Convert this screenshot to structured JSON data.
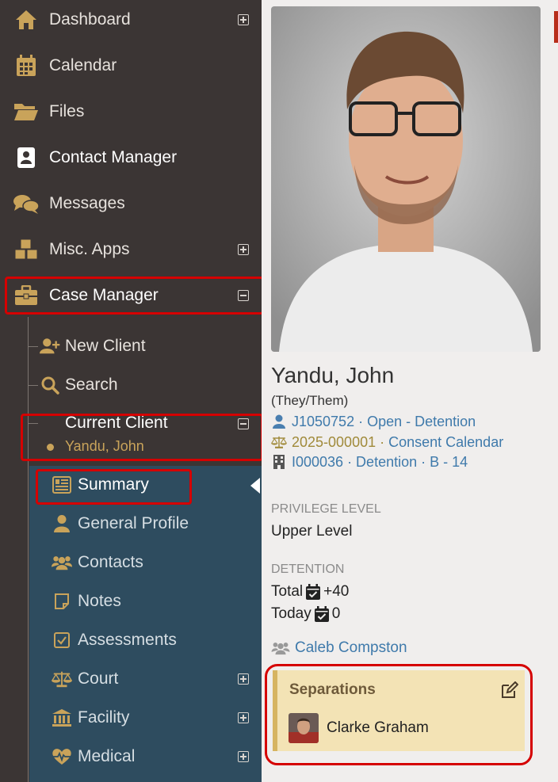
{
  "sidebar": {
    "items": [
      {
        "label": "Dashboard",
        "icon": "home-icon",
        "expander": "plus"
      },
      {
        "label": "Calendar",
        "icon": "calendar-icon",
        "expander": ""
      },
      {
        "label": "Files",
        "icon": "folder-icon",
        "expander": ""
      },
      {
        "label": "Contact Manager",
        "icon": "contact-card-icon",
        "expander": ""
      },
      {
        "label": "Messages",
        "icon": "chat-bubbles-icon",
        "expander": ""
      },
      {
        "label": "Misc. Apps",
        "icon": "cubes-icon",
        "expander": "plus"
      },
      {
        "label": "Case Manager",
        "icon": "briefcase-icon",
        "expander": "minus"
      }
    ],
    "case_manager": {
      "new_client": "New Client",
      "search": "Search",
      "current_client": "Current Client",
      "current_client_name": "Yandu, John"
    },
    "client_menu": [
      {
        "label": "Summary",
        "icon": "summary-icon",
        "expander": ""
      },
      {
        "label": "General Profile",
        "icon": "user-icon",
        "expander": ""
      },
      {
        "label": "Contacts",
        "icon": "users-icon",
        "expander": ""
      },
      {
        "label": "Notes",
        "icon": "note-icon",
        "expander": ""
      },
      {
        "label": "Assessments",
        "icon": "check-square-icon",
        "expander": ""
      },
      {
        "label": "Court",
        "icon": "scales-icon",
        "expander": "plus"
      },
      {
        "label": "Facility",
        "icon": "building-columns-icon",
        "expander": "plus"
      },
      {
        "label": "Medical",
        "icon": "heartbeat-icon",
        "expander": "plus"
      }
    ]
  },
  "client": {
    "name": "Yandu, John",
    "pronouns": "(They/Them)",
    "booking_id": "J1050752",
    "booking_status": "Open - Detention",
    "case_number": "2025-000001",
    "case_calendar": "Consent Calendar",
    "facility_line": "I000036 · Detention · B - 14",
    "privilege_label": "PRIVILEGE LEVEL",
    "privilege_value": "Upper Level",
    "detention_label": "DETENTION",
    "total_label": "Total",
    "total_value": "+40",
    "today_label": "Today",
    "today_value": "0",
    "contact_name": "Caleb Compston",
    "separations_title": "Separations",
    "separation_person": "Clarke Graham"
  },
  "colors": {
    "sidebar": "#3b3534",
    "client_menu": "#2e4c5f",
    "accent_gold": "#c9a35a",
    "link_blue": "#3f7aab",
    "highlight_red": "#d50000",
    "separation_bg": "#f3e3b5"
  }
}
